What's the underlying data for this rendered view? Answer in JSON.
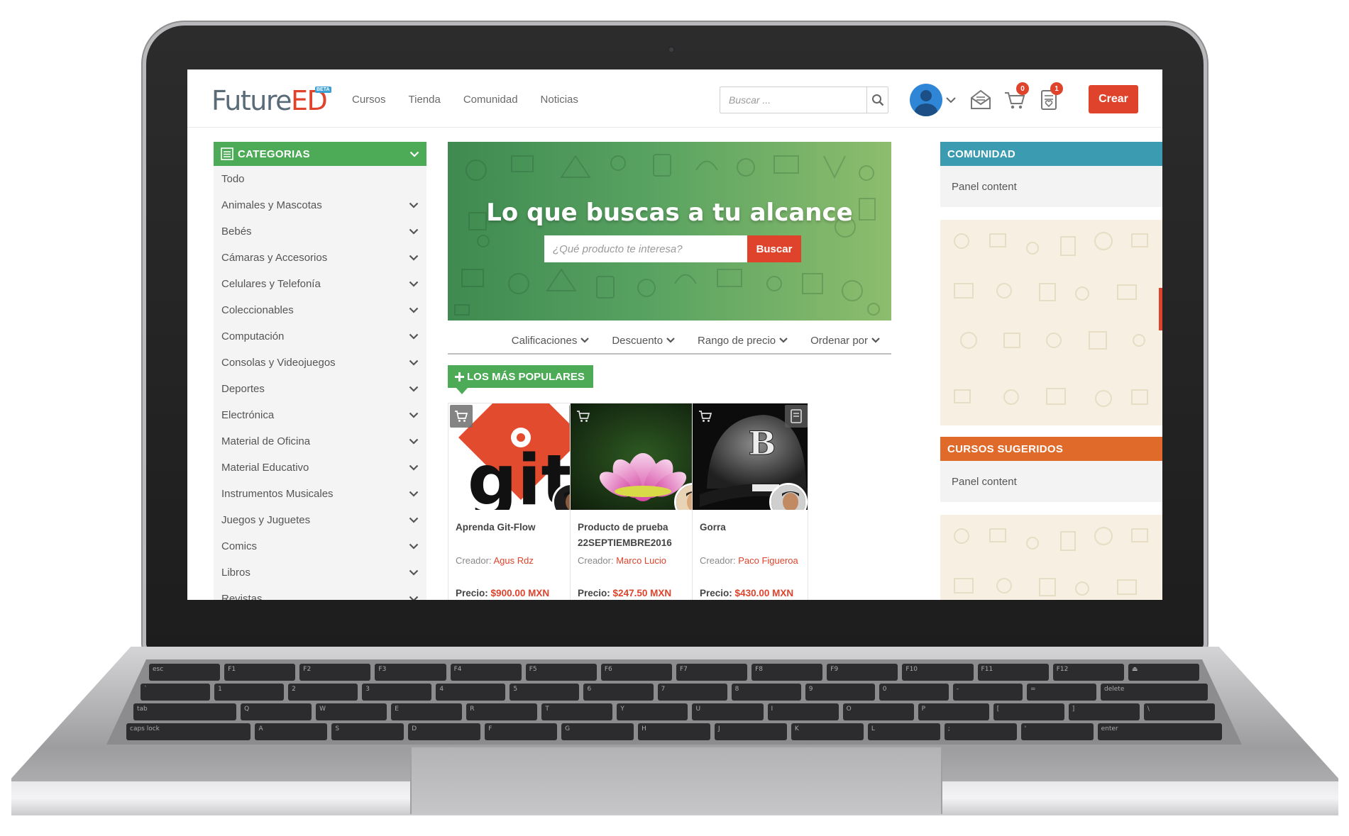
{
  "header": {
    "logo_prefix": "Future",
    "logo_suffix": "ED",
    "logo_badge": "BETA",
    "nav": [
      "Cursos",
      "Tienda",
      "Comunidad",
      "Noticias"
    ],
    "search_placeholder": "Buscar ...",
    "cart_count": "0",
    "list_count": "1",
    "create_label": "Crear"
  },
  "sidebar": {
    "title": "CATEGORIAS",
    "items": [
      {
        "label": "Todo",
        "expandable": false
      },
      {
        "label": "Animales y Mascotas",
        "expandable": true
      },
      {
        "label": "Bebés",
        "expandable": true
      },
      {
        "label": "Cámaras y Accesorios",
        "expandable": true
      },
      {
        "label": "Celulares y Telefonía",
        "expandable": true
      },
      {
        "label": "Coleccionables",
        "expandable": true
      },
      {
        "label": "Computación",
        "expandable": true
      },
      {
        "label": "Consolas y Videojuegos",
        "expandable": true
      },
      {
        "label": "Deportes",
        "expandable": true
      },
      {
        "label": "Electrónica",
        "expandable": true
      },
      {
        "label": "Material de Oficina",
        "expandable": true
      },
      {
        "label": "Material Educativo",
        "expandable": true
      },
      {
        "label": "Instrumentos Musicales",
        "expandable": true
      },
      {
        "label": "Juegos y Juguetes",
        "expandable": true
      },
      {
        "label": "Comics",
        "expandable": true
      },
      {
        "label": "Libros",
        "expandable": true
      },
      {
        "label": "Revistas",
        "expandable": true
      }
    ]
  },
  "hero": {
    "title": "Lo que buscas a tu alcance",
    "search_placeholder": "¿Qué producto te interesa?",
    "search_button": "Buscar"
  },
  "filters": [
    "Calificaciones",
    "Descuento",
    "Rango de precio",
    "Ordenar por"
  ],
  "popular": {
    "label": "LOS MÁS POPULARES",
    "creator_prefix": "Creador:",
    "price_prefix": "Precio:",
    "products": [
      {
        "title": "Aprenda Git-Flow",
        "creator": "Agus Rdz",
        "price": "$900.00 MXN",
        "image": "git-logo"
      },
      {
        "title": "Producto de prueba 22SEPTIEMBRE2016",
        "creator": "Marco Lucio",
        "price": "$247.50 MXN",
        "image": "lotus-flower"
      },
      {
        "title": "Gorra",
        "creator": "Paco Figueroa",
        "price": "$430.00 MXN",
        "image": "baseball-cap"
      }
    ]
  },
  "right": {
    "comunidad_title": "COMUNIDAD",
    "comunidad_body": "Panel content",
    "cursos_title": "CURSOS SUGERIDOS",
    "cursos_body": "Panel content"
  },
  "colors": {
    "brand_red": "#e0432b",
    "green": "#4daa57",
    "teal": "#3b9bb0",
    "orange": "#e06a2a"
  }
}
